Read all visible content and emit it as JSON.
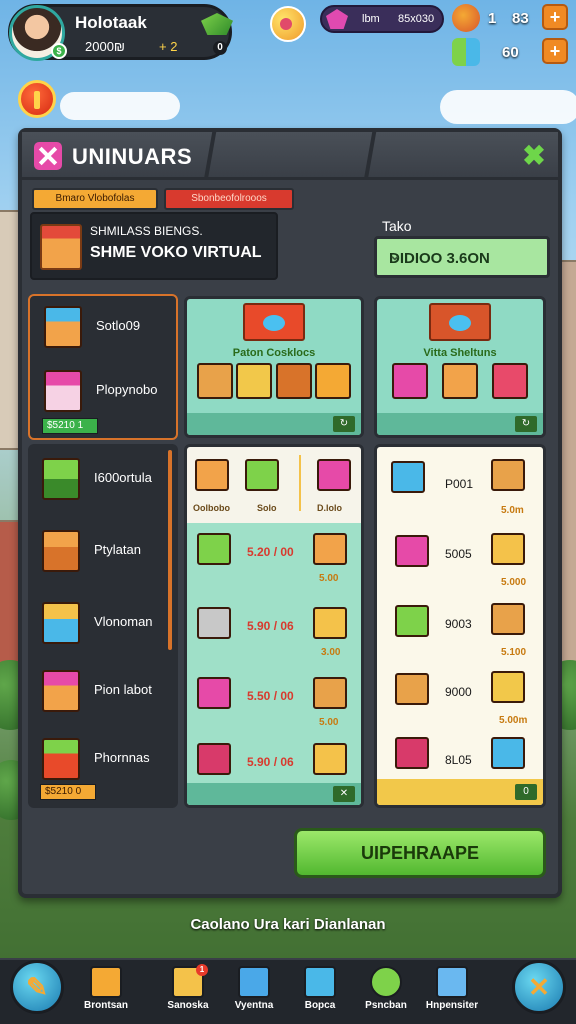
{
  "colors": {
    "accent_orange": "#f4a934",
    "accent_red": "#d83a2e",
    "accent_green": "#52b830",
    "panel_dark": "#3a3f47",
    "card_mint": "#8fdac4"
  },
  "hud": {
    "player_name": "Holotaak",
    "money": "2000₪",
    "money_delta": "+ 2",
    "gem_label": "lbm",
    "gem_value": "85x030",
    "stat1_a": "1",
    "stat1_b": "83",
    "stat2_value": "60",
    "plus_symbol": "+",
    "alert_icon": "alert-icon"
  },
  "panel": {
    "title": "UNINUARS",
    "close_symbol": "✖",
    "tabs": [
      "Bmaro Vlobofolas",
      "Sbonbeofolrooos"
    ],
    "business_line1": "SHMILASS BIENGS.",
    "business_line2": "SHME VOKO VIRTUAL",
    "dropdown_label": "Tako",
    "dropdown_value": "DIDIOO 3.6ON",
    "dropdown_chevron": "⌄"
  },
  "side_list_top": [
    {
      "label": "Sotlo09"
    },
    {
      "label": "Plopynobo"
    }
  ],
  "side_top_badge": "$5210 1",
  "side_list_bottom": [
    {
      "label": "I600ortula"
    },
    {
      "label": "Ptylatan"
    },
    {
      "label": "Vlonoman"
    },
    {
      "label": "Pion labot"
    },
    {
      "label": "Phornnas"
    }
  ],
  "side_bottom_badge": "$5210 0",
  "cards_top": [
    {
      "name": "Paton Cosklocs",
      "footer_icon": "↻"
    },
    {
      "name": "Vitta Sheltuns",
      "footer_icon": "↻"
    }
  ],
  "market_mid": {
    "header_tags": [
      "Oolbobo",
      "Solo",
      "D.lolo"
    ],
    "rows": [
      {
        "price": "5.20 / 00",
        "sub": "5.00"
      },
      {
        "price": "5.90 / 06",
        "sub": "3.00"
      },
      {
        "price": "5.50 / 00",
        "sub": "5.00"
      },
      {
        "price": "5.90 / 06",
        "sub": ""
      }
    ],
    "footer_icon": "✕"
  },
  "market_right": {
    "rows": [
      {
        "code": "P001",
        "sub": "5.0m"
      },
      {
        "code": "5005",
        "sub": "5.000"
      },
      {
        "code": "9003",
        "sub": "5.100"
      },
      {
        "code": "9000",
        "sub": "5.00m"
      },
      {
        "code": "8L05",
        "sub": ""
      }
    ],
    "footer_icon": "0"
  },
  "upgrade_button": "UIPEHRAAPE",
  "footer_caption": "Caolano Ura kari Dianlanan",
  "bottom_nav": [
    {
      "label": "Brontsan",
      "icon": "crate-icon",
      "color": "#f4a934"
    },
    {
      "label": "Sanoska",
      "icon": "gift-box-icon",
      "color": "#f4c24a",
      "badge": "1"
    },
    {
      "label": "Vyentna",
      "icon": "tools-icon",
      "color": "#4aa8e8"
    },
    {
      "label": "Bopca",
      "icon": "document-icon",
      "color": "#4ab8e8"
    },
    {
      "label": "Psncban",
      "icon": "coin-icon",
      "color": "#7ed24a"
    },
    {
      "label": "Hnpensiter",
      "icon": "clipboard-icon",
      "color": "#6ab8f0"
    }
  ],
  "bottom_left_glyph": "✎",
  "bottom_right_glyph": "✕"
}
